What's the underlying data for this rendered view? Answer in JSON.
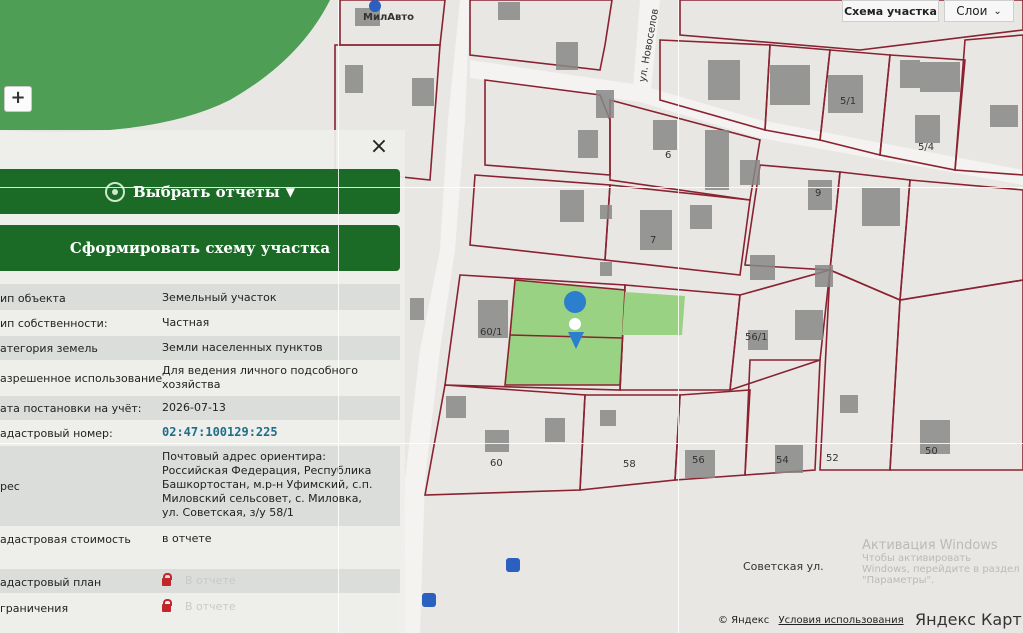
{
  "map": {
    "place_label": "МилАвто",
    "street_vertical": "ул. Новоселов",
    "street_bottom": "Советская ул.",
    "house_numbers": [
      "6",
      "7",
      "9",
      "5/1",
      "5/4",
      "56/1",
      "60",
      "58",
      "56",
      "54",
      "52",
      "50",
      "60/1"
    ],
    "parcel_color": "#9ad283",
    "boundary_color": "#8a2230"
  },
  "controls": {
    "scheme_label": "Схема участка",
    "layers_label": "Слои",
    "zoom_in": "+"
  },
  "panel": {
    "close_symbol": "×",
    "select_reports_label": "Выбрать отчеты",
    "select_reports_caret": "▼",
    "form_scheme_label": "Сформировать схему участка",
    "rows": [
      {
        "label": "ип объекта",
        "value": "Земельный участок"
      },
      {
        "label": "ип собственности:",
        "value": "Частная"
      },
      {
        "label": "атегория земель",
        "value": "Земли населенных пунктов"
      },
      {
        "label": "азрешенное использование",
        "value": "Для ведения личного подсобного хозяйства"
      },
      {
        "label": "ата постановки на учёт:",
        "value": "2026-07-13"
      },
      {
        "label": "адастровый номер:",
        "value": "02:47:100129:225"
      },
      {
        "label": "рес",
        "value": "Почтовый адрес ориентира: Российская Федерация, Республика Башкортостан, м.р-н Уфимский, с.п. Миловский сельсовет, с. Миловка, ул. Советская, з/у 58/1"
      },
      {
        "label": "адастровая стоимость",
        "value": "в отчете"
      },
      {
        "label": "адастровый план",
        "value": "В отчете"
      },
      {
        "label": "граничения",
        "value": "В отчете"
      }
    ]
  },
  "footer": {
    "copyright": "© Яндекс",
    "terms": "Условия использования",
    "logo": "Яндекс Карт"
  },
  "watermark": {
    "line1": "Активация Windows",
    "line2": "Чтобы активировать Windows, перейдите в раздел \"Параметры\"."
  }
}
